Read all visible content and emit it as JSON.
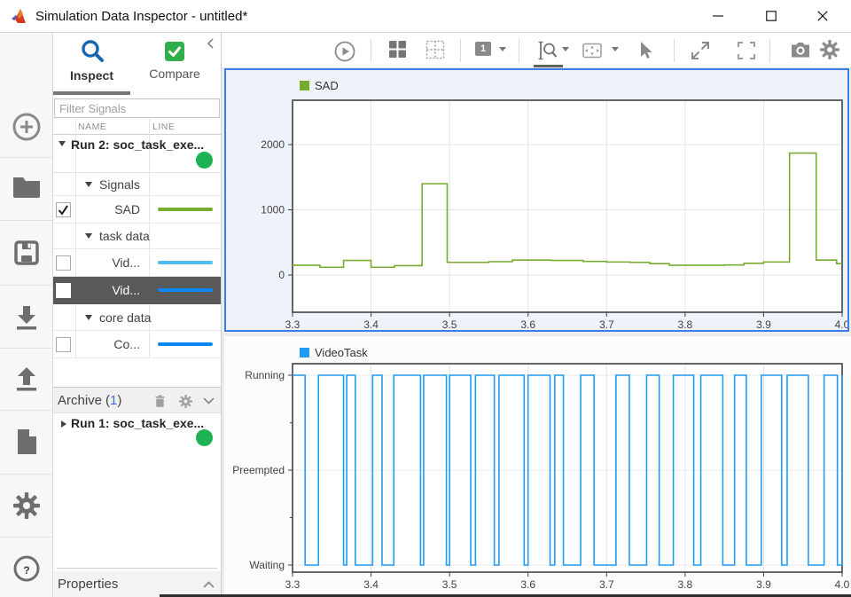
{
  "window": {
    "title": "Simulation Data Inspector - untitled*"
  },
  "icons": {
    "help_glyph": "?"
  },
  "colors": {
    "selection_blue": "#3c7de9",
    "run_dot_green": "#1db254",
    "sad_green": "#77ac30",
    "light_blue": "#4dbeee",
    "bright_blue": "#0c85f2",
    "video_trace_blue": "#1f9cf4",
    "inspect_blue": "#1668b0",
    "compare_green": "#2fae49"
  },
  "sidebar": {
    "tabs": [
      {
        "label": "Inspect"
      },
      {
        "label": "Compare"
      }
    ],
    "filter_placeholder": "Filter Signals",
    "columns": [
      "NAME",
      "LINE"
    ],
    "run2_label": "Run 2: soc_task_exe...",
    "rows": [
      {
        "type": "group",
        "label": "Signals"
      },
      {
        "type": "signal",
        "label": "SAD",
        "checked": true,
        "color": "sad_green"
      },
      {
        "type": "group",
        "label": "task data"
      },
      {
        "type": "signal",
        "label": "Vid...",
        "checked": false,
        "color": "light_blue"
      },
      {
        "type": "signal",
        "label": "Vid...",
        "checked": false,
        "color": "bright_blue",
        "selected": true
      },
      {
        "type": "group",
        "label": "core data"
      },
      {
        "type": "signal",
        "label": "Co...",
        "checked": false,
        "color": "bright_blue"
      }
    ],
    "archive": {
      "label": "Archive",
      "paren_open": "(",
      "count": "1",
      "paren_close": ")"
    },
    "run1_label": "Run 1: soc_task_exe...",
    "properties_label": "Properties"
  },
  "toolbar": {
    "layout_number": "1"
  },
  "chart_data": [
    {
      "type": "line",
      "step": true,
      "title": "SAD",
      "color": "#77ac30",
      "xlim": [
        3.3,
        4.0
      ],
      "ylim": [
        -570,
        2680
      ],
      "x_ticks": [
        3.3,
        3.4,
        3.5,
        3.6,
        3.7,
        3.8,
        3.9,
        4.0
      ],
      "y_ticks": [
        0,
        1000,
        2000
      ],
      "grid": true,
      "legend_position": "top-left",
      "points": [
        [
          3.3,
          150
        ],
        [
          3.335,
          120
        ],
        [
          3.365,
          225
        ],
        [
          3.4,
          120
        ],
        [
          3.43,
          145
        ],
        [
          3.465,
          1400
        ],
        [
          3.497,
          195
        ],
        [
          3.55,
          205
        ],
        [
          3.58,
          230
        ],
        [
          3.63,
          225
        ],
        [
          3.67,
          210
        ],
        [
          3.7,
          200
        ],
        [
          3.73,
          195
        ],
        [
          3.755,
          175
        ],
        [
          3.78,
          150
        ],
        [
          3.85,
          155
        ],
        [
          3.875,
          180
        ],
        [
          3.9,
          200
        ],
        [
          3.933,
          1870
        ],
        [
          3.967,
          230
        ],
        [
          3.993,
          175
        ],
        [
          4.0,
          175
        ]
      ]
    },
    {
      "type": "line",
      "kind": "state-square-wave",
      "title": "VideoTask",
      "color": "#1f9cf4",
      "xlim": [
        3.3,
        4.0
      ],
      "x_ticks": [
        3.3,
        3.4,
        3.5,
        3.6,
        3.7,
        3.8,
        3.9,
        4.0
      ],
      "y_tick_labels": [
        "Running",
        "Preempted",
        "Waiting"
      ],
      "high_state": "Running",
      "low_state": "Waiting",
      "grid": true,
      "low_intervals": [
        [
          3.316,
          3.333
        ],
        [
          3.365,
          3.369
        ],
        [
          3.38,
          3.402
        ],
        [
          3.414,
          3.429
        ],
        [
          3.463,
          3.467
        ],
        [
          3.496,
          3.5
        ],
        [
          3.527,
          3.533
        ],
        [
          3.557,
          3.563
        ],
        [
          3.595,
          3.6
        ],
        [
          3.628,
          3.634
        ],
        [
          3.645,
          3.667
        ],
        [
          3.684,
          3.712
        ],
        [
          3.729,
          3.751
        ],
        [
          3.767,
          3.785
        ],
        [
          3.811,
          3.82
        ],
        [
          3.848,
          3.863
        ],
        [
          3.878,
          3.897
        ],
        [
          3.923,
          3.93
        ],
        [
          3.957,
          3.977
        ],
        [
          3.994,
          4.0
        ]
      ]
    }
  ]
}
